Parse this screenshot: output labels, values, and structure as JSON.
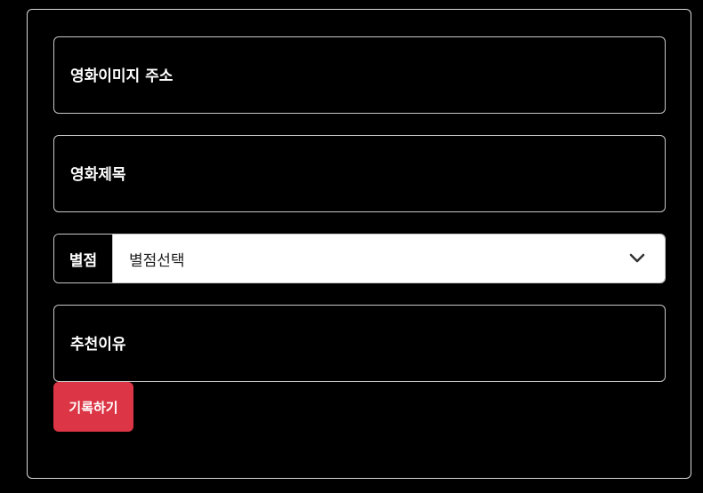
{
  "form": {
    "image_url_placeholder": "영화이미지 주소",
    "title_placeholder": "영화제목",
    "rating_label": "별점",
    "rating_selected": "별점선택",
    "reason_placeholder": "추천이유",
    "submit_label": "기록하기"
  },
  "icons": {
    "select_arrow": "chevron-down-icon"
  },
  "colors": {
    "background": "#000000",
    "border": "#c8c8c8",
    "submit_button": "#dc3545",
    "select_background": "#ffffff"
  }
}
